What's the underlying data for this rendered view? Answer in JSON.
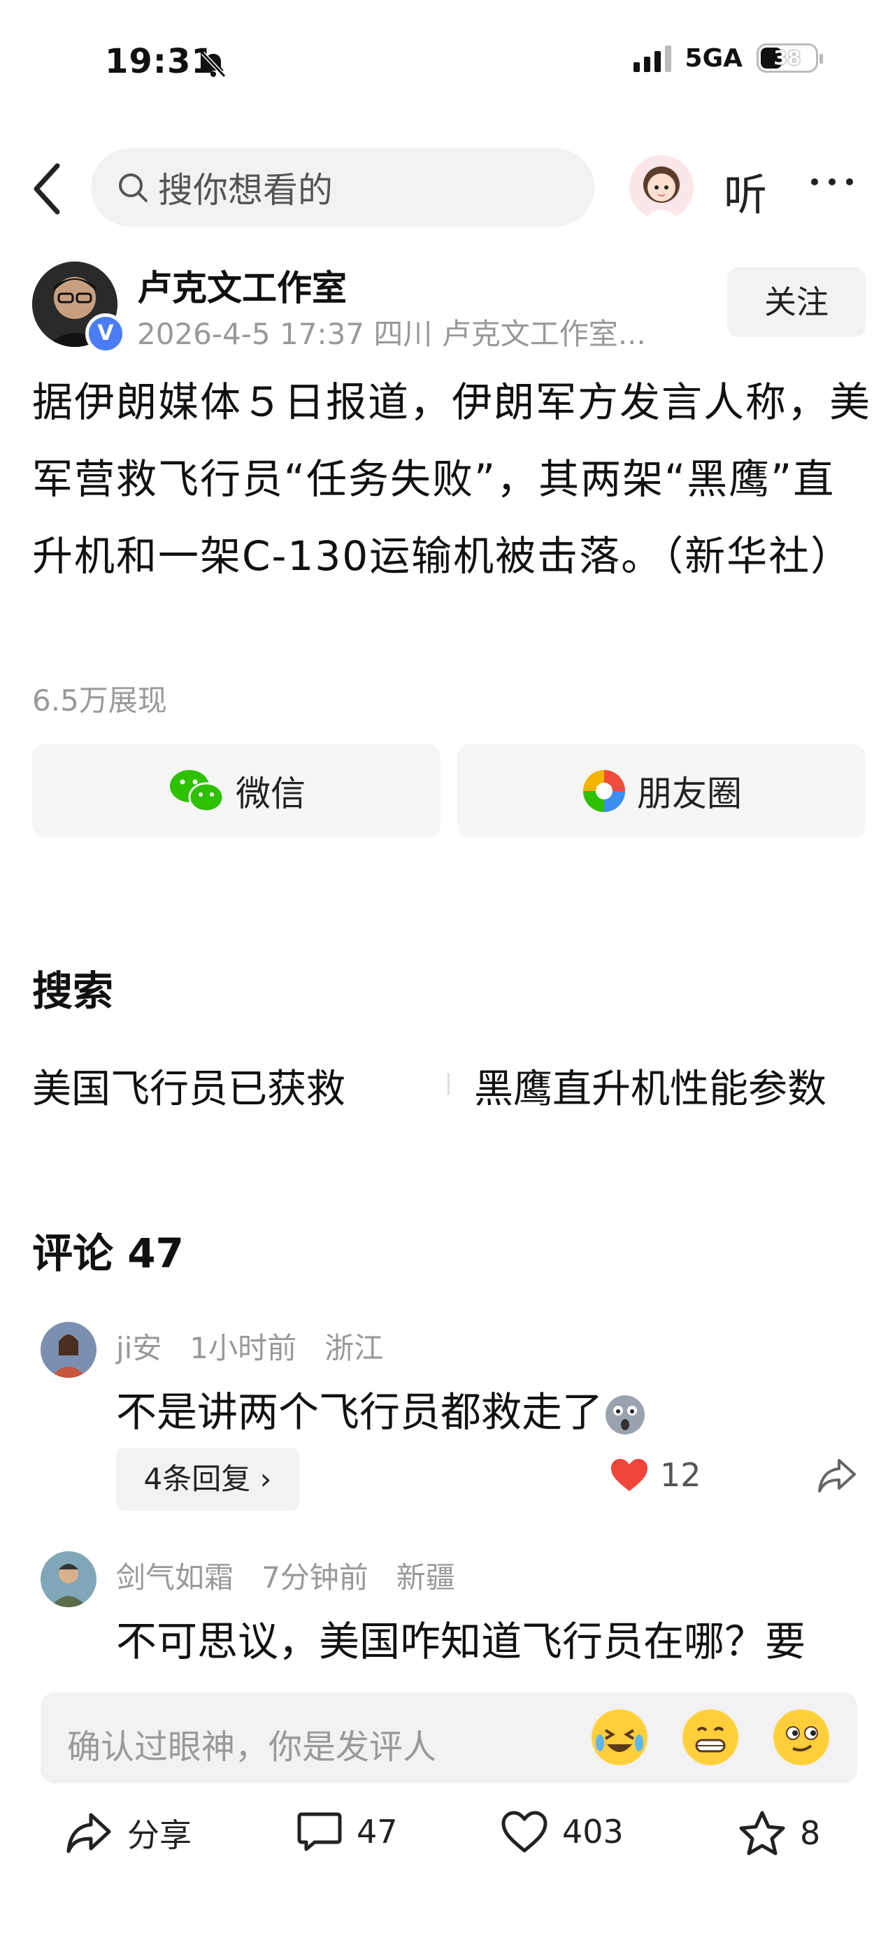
{
  "status": {
    "time": "19:31",
    "network": "5GA",
    "battery": "38"
  },
  "nav": {
    "search_placeholder": "搜你想看的",
    "listen_label": "听"
  },
  "author": {
    "name": "卢克文工作室",
    "meta": "2026-4-5 17:37  四川  卢克文工作室...",
    "verify_badge": "V",
    "follow_label": "关注"
  },
  "article": {
    "text": "据伊朗媒体５日报道，伊朗军方发言人称，美军营救飞行员“任务失败”，其两架“黑鹰”直升机和一架C-130运输机被击落。（新华社）",
    "views": "6.5万展现"
  },
  "share": {
    "wechat_label": "微信",
    "moments_label": "朋友圈"
  },
  "search_section": {
    "title": "搜索",
    "items": [
      "美国飞行员已获救",
      "黑鹰直升机性能参数"
    ]
  },
  "comments": {
    "title": "评论 47",
    "list": [
      {
        "user": "ji安",
        "time": "1小时前",
        "location": "浙江",
        "text": "不是讲两个飞行员都救走了",
        "replies": "4条回复",
        "likes": "12"
      },
      {
        "user": "剑气如霜",
        "time": "7分钟前",
        "location": "新疆",
        "text": "不可思议，美国咋知道飞行员在哪？要"
      }
    ]
  },
  "input": {
    "placeholder": "确认过眼神，你是发评人"
  },
  "bottom": {
    "share_label": "分享",
    "comments_count": "47",
    "likes_count": "403",
    "favorites_count": "8"
  },
  "colors": {
    "like_red": "#f0453a",
    "verify_blue": "#4a7cf6",
    "wechat_green": "#2dc100"
  }
}
